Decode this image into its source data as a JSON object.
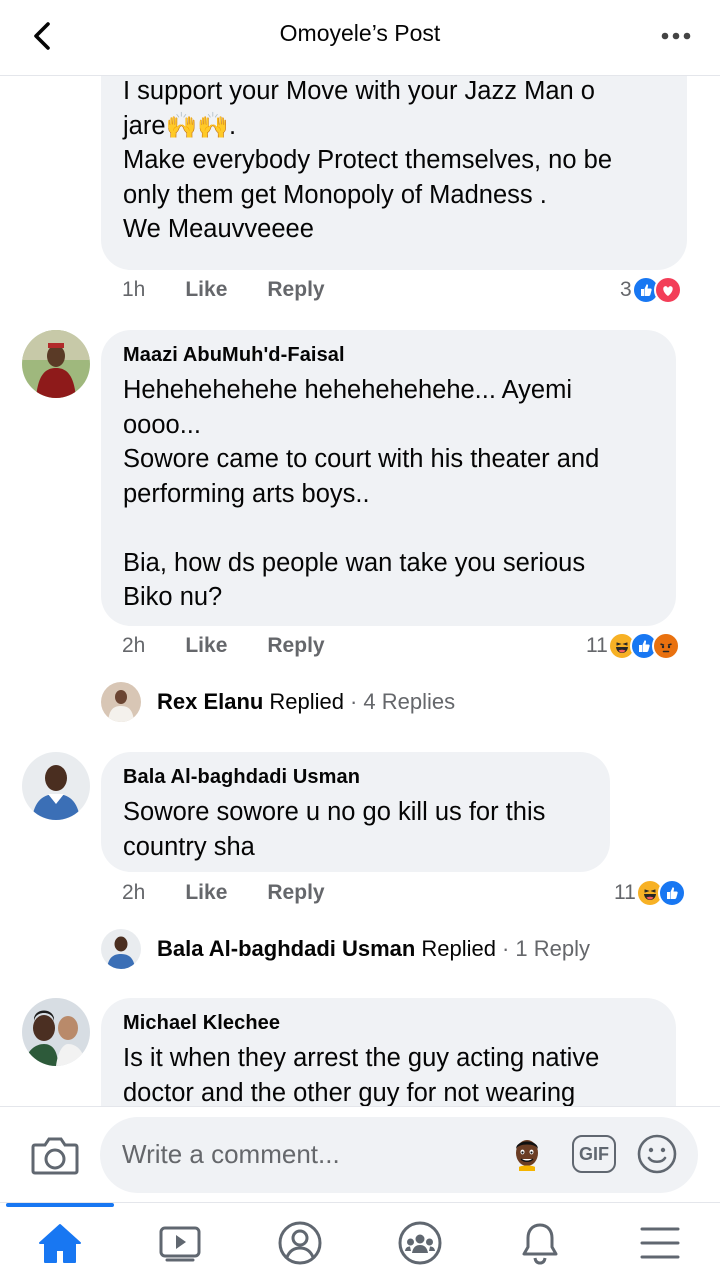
{
  "header": {
    "title": "Omoyele’s Post"
  },
  "comments": [
    {
      "text": "I support your Move with your Jazz Man o\njare🙌🙌.\nMake everybody Protect themselves, no be\nonly them get Monopoly of Madness .\nWe Meauvveeee",
      "time": "1h",
      "like": "Like",
      "reply": "Reply",
      "reaction_count": "3",
      "reactions": [
        "like-icon",
        "love-icon"
      ]
    },
    {
      "author": "Maazi AbuMuh'd-Faisal",
      "text": "Hehehehehehe hehehehehehe... Ayemi\noooo...\nSowore came to court with his theater and\nperforming arts boys..\n\nBia, how ds people wan take you serious\nBiko nu?",
      "time": "2h",
      "like": "Like",
      "reply": "Reply",
      "reaction_count": "11",
      "reactions": [
        "haha-icon",
        "like-icon",
        "angry-icon"
      ],
      "replies": {
        "name": "Rex Elanu",
        "verb": "Replied",
        "count": "· 4 Replies"
      }
    },
    {
      "author": "Bala Al-baghdadi Usman",
      "text": "Sowore sowore u no go kill us for this\ncountry sha",
      "time": "2h",
      "like": "Like",
      "reply": "Reply",
      "reaction_count": "11",
      "reactions": [
        "haha-icon",
        "like-icon"
      ],
      "replies": {
        "name": "Bala Al-baghdadi Usman",
        "verb": "Replied",
        "count": "· 1 Reply"
      }
    },
    {
      "author": "Michael Klechee",
      "text": "Is it when they arrest the guy acting native\ndoctor and the other guy for not wearing"
    }
  ],
  "composer": {
    "placeholder": "Write a comment...",
    "gif_label": "GIF"
  },
  "colors": {
    "accent": "#1877f2",
    "bubble": "#f0f2f5",
    "secondary_text": "#65676b"
  }
}
